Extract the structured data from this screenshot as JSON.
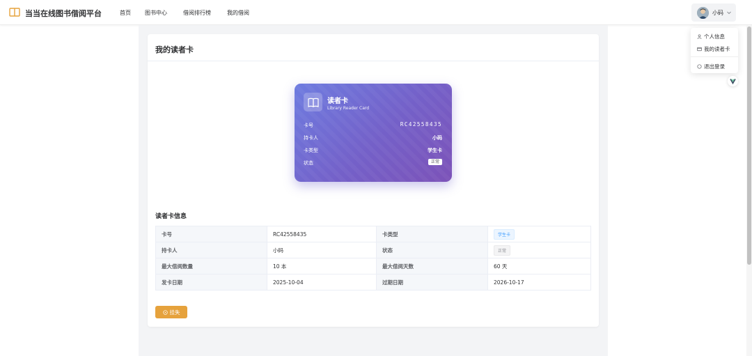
{
  "header": {
    "site_title": "当当在线图书借阅平台",
    "nav": [
      "首页",
      "图书中心",
      "借阅排行榜",
      "我的借阅"
    ],
    "user_name": "小码"
  },
  "dropdown": {
    "items": [
      "个人信息",
      "我的读者卡",
      "退出登录"
    ]
  },
  "panel": {
    "title": "我的读者卡"
  },
  "reader_card": {
    "title": "读者卡",
    "subtitle": "Library Reader Card",
    "rows": [
      {
        "label": "卡号",
        "value": "RC42558435"
      },
      {
        "label": "持卡人",
        "value": "小码"
      },
      {
        "label": "卡类型",
        "value": "学生卡"
      },
      {
        "label": "状态",
        "value": "正常"
      }
    ]
  },
  "info": {
    "title": "读者卡信息",
    "rows": [
      {
        "l1": "卡号",
        "v1": "RC42558435",
        "l2": "卡类型",
        "v2": "学生卡"
      },
      {
        "l1": "持卡人",
        "v1": "小码",
        "l2": "状态",
        "v2": "正常"
      },
      {
        "l1": "最大借阅数量",
        "v1": "10 本",
        "l2": "最大借阅天数",
        "v2": "60 天"
      },
      {
        "l1": "发卡日期",
        "v1": "2025-10-04",
        "l2": "过期日期",
        "v2": "2026-10-17"
      }
    ]
  },
  "actions": {
    "report_loss": "挂失"
  },
  "colors": {
    "accent_warning": "#e6a23c",
    "card_gradient_start": "#6e7ce0",
    "card_gradient_end": "#7c52b8",
    "tag_blue": "#409eff"
  }
}
